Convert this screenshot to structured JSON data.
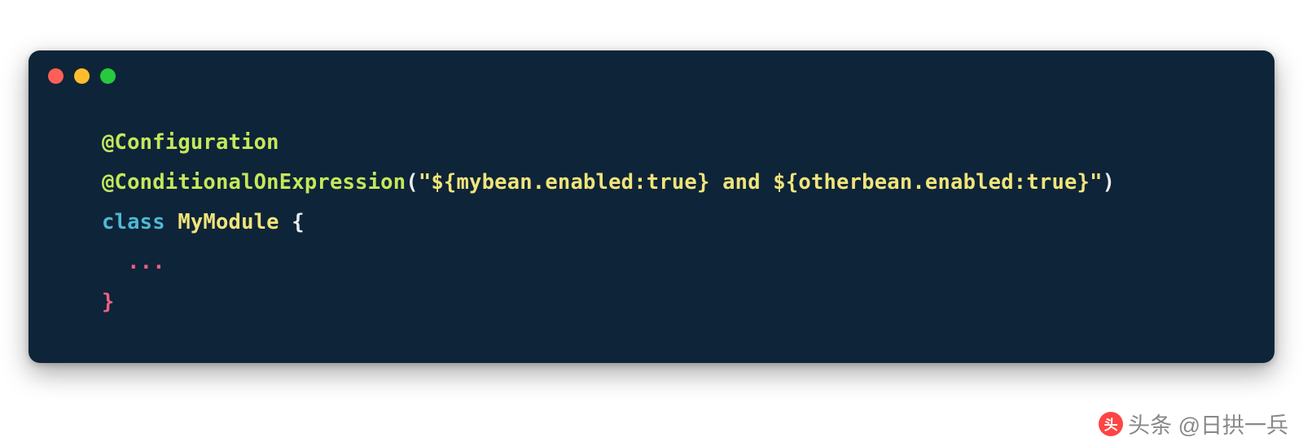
{
  "code": {
    "line1": {
      "annotation": "@Configuration"
    },
    "line2": {
      "annotation": "@ConditionalOnExpression",
      "paren_open": "(",
      "string": "\"${mybean.enabled:true} and ${otherbean.enabled:true}\"",
      "paren_close": ")"
    },
    "line3": {
      "keyword": "class",
      "classname": " MyModule ",
      "brace": "{"
    },
    "line4": {
      "ellipsis": "  ..."
    },
    "line5": {
      "close": "}"
    }
  },
  "watermark": {
    "icon_text": "头",
    "text": "头条 @日拱一兵"
  },
  "colors": {
    "window_bg": "#0e2438",
    "red": "#ff5f56",
    "yellow": "#ffbd2e",
    "green": "#27c93f",
    "annotation": "#c4e85a",
    "string": "#f0e47a",
    "keyword": "#4fb8d4",
    "punct": "#f25f82"
  }
}
